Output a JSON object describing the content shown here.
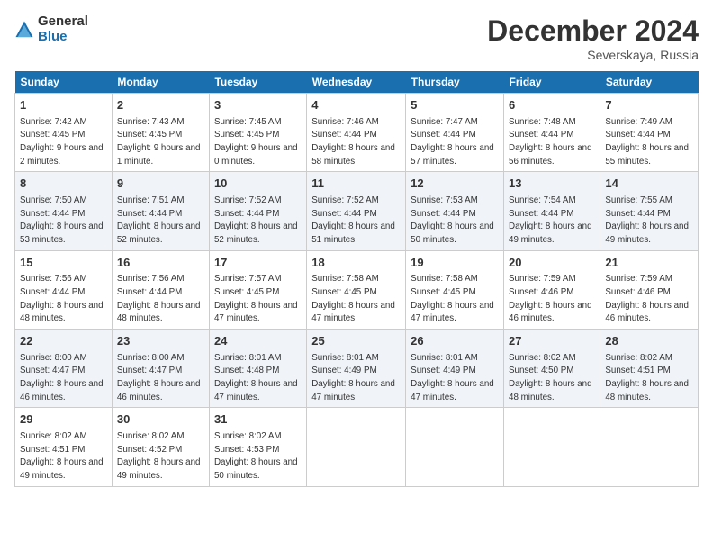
{
  "logo": {
    "general": "General",
    "blue": "Blue"
  },
  "header": {
    "month": "December 2024",
    "location": "Severskaya, Russia"
  },
  "days_of_week": [
    "Sunday",
    "Monday",
    "Tuesday",
    "Wednesday",
    "Thursday",
    "Friday",
    "Saturday"
  ],
  "weeks": [
    [
      {
        "day": "1",
        "sunrise": "7:42 AM",
        "sunset": "4:45 PM",
        "daylight": "9 hours and 2 minutes."
      },
      {
        "day": "2",
        "sunrise": "7:43 AM",
        "sunset": "4:45 PM",
        "daylight": "9 hours and 1 minute."
      },
      {
        "day": "3",
        "sunrise": "7:45 AM",
        "sunset": "4:45 PM",
        "daylight": "9 hours and 0 minutes."
      },
      {
        "day": "4",
        "sunrise": "7:46 AM",
        "sunset": "4:44 PM",
        "daylight": "8 hours and 58 minutes."
      },
      {
        "day": "5",
        "sunrise": "7:47 AM",
        "sunset": "4:44 PM",
        "daylight": "8 hours and 57 minutes."
      },
      {
        "day": "6",
        "sunrise": "7:48 AM",
        "sunset": "4:44 PM",
        "daylight": "8 hours and 56 minutes."
      },
      {
        "day": "7",
        "sunrise": "7:49 AM",
        "sunset": "4:44 PM",
        "daylight": "8 hours and 55 minutes."
      }
    ],
    [
      {
        "day": "8",
        "sunrise": "7:50 AM",
        "sunset": "4:44 PM",
        "daylight": "8 hours and 53 minutes."
      },
      {
        "day": "9",
        "sunrise": "7:51 AM",
        "sunset": "4:44 PM",
        "daylight": "8 hours and 52 minutes."
      },
      {
        "day": "10",
        "sunrise": "7:52 AM",
        "sunset": "4:44 PM",
        "daylight": "8 hours and 52 minutes."
      },
      {
        "day": "11",
        "sunrise": "7:52 AM",
        "sunset": "4:44 PM",
        "daylight": "8 hours and 51 minutes."
      },
      {
        "day": "12",
        "sunrise": "7:53 AM",
        "sunset": "4:44 PM",
        "daylight": "8 hours and 50 minutes."
      },
      {
        "day": "13",
        "sunrise": "7:54 AM",
        "sunset": "4:44 PM",
        "daylight": "8 hours and 49 minutes."
      },
      {
        "day": "14",
        "sunrise": "7:55 AM",
        "sunset": "4:44 PM",
        "daylight": "8 hours and 49 minutes."
      }
    ],
    [
      {
        "day": "15",
        "sunrise": "7:56 AM",
        "sunset": "4:44 PM",
        "daylight": "8 hours and 48 minutes."
      },
      {
        "day": "16",
        "sunrise": "7:56 AM",
        "sunset": "4:44 PM",
        "daylight": "8 hours and 48 minutes."
      },
      {
        "day": "17",
        "sunrise": "7:57 AM",
        "sunset": "4:45 PM",
        "daylight": "8 hours and 47 minutes."
      },
      {
        "day": "18",
        "sunrise": "7:58 AM",
        "sunset": "4:45 PM",
        "daylight": "8 hours and 47 minutes."
      },
      {
        "day": "19",
        "sunrise": "7:58 AM",
        "sunset": "4:45 PM",
        "daylight": "8 hours and 47 minutes."
      },
      {
        "day": "20",
        "sunrise": "7:59 AM",
        "sunset": "4:46 PM",
        "daylight": "8 hours and 46 minutes."
      },
      {
        "day": "21",
        "sunrise": "7:59 AM",
        "sunset": "4:46 PM",
        "daylight": "8 hours and 46 minutes."
      }
    ],
    [
      {
        "day": "22",
        "sunrise": "8:00 AM",
        "sunset": "4:47 PM",
        "daylight": "8 hours and 46 minutes."
      },
      {
        "day": "23",
        "sunrise": "8:00 AM",
        "sunset": "4:47 PM",
        "daylight": "8 hours and 46 minutes."
      },
      {
        "day": "24",
        "sunrise": "8:01 AM",
        "sunset": "4:48 PM",
        "daylight": "8 hours and 47 minutes."
      },
      {
        "day": "25",
        "sunrise": "8:01 AM",
        "sunset": "4:49 PM",
        "daylight": "8 hours and 47 minutes."
      },
      {
        "day": "26",
        "sunrise": "8:01 AM",
        "sunset": "4:49 PM",
        "daylight": "8 hours and 47 minutes."
      },
      {
        "day": "27",
        "sunrise": "8:02 AM",
        "sunset": "4:50 PM",
        "daylight": "8 hours and 48 minutes."
      },
      {
        "day": "28",
        "sunrise": "8:02 AM",
        "sunset": "4:51 PM",
        "daylight": "8 hours and 48 minutes."
      }
    ],
    [
      {
        "day": "29",
        "sunrise": "8:02 AM",
        "sunset": "4:51 PM",
        "daylight": "8 hours and 49 minutes."
      },
      {
        "day": "30",
        "sunrise": "8:02 AM",
        "sunset": "4:52 PM",
        "daylight": "8 hours and 49 minutes."
      },
      {
        "day": "31",
        "sunrise": "8:02 AM",
        "sunset": "4:53 PM",
        "daylight": "8 hours and 50 minutes."
      },
      null,
      null,
      null,
      null
    ]
  ]
}
